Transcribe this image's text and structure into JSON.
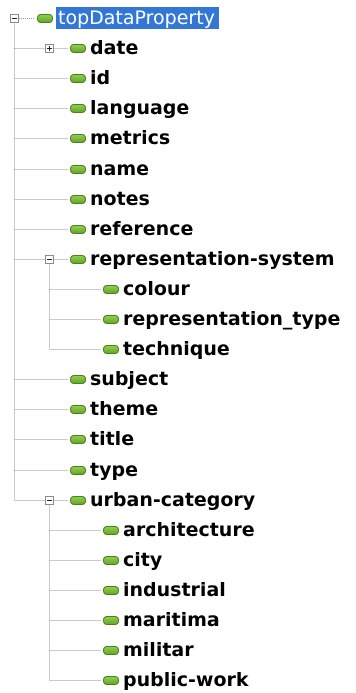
{
  "tree": {
    "nodes": [
      {
        "label": "topDataProperty",
        "depth": 0,
        "selected": true,
        "toggle": "minus",
        "icon": "data-property-icon"
      },
      {
        "label": "date",
        "depth": 1,
        "toggle": "plus",
        "icon": "data-property-icon"
      },
      {
        "label": "id",
        "depth": 1,
        "icon": "data-property-icon"
      },
      {
        "label": "language",
        "depth": 1,
        "icon": "data-property-icon"
      },
      {
        "label": "metrics",
        "depth": 1,
        "icon": "data-property-icon"
      },
      {
        "label": "name",
        "depth": 1,
        "icon": "data-property-icon"
      },
      {
        "label": "notes",
        "depth": 1,
        "icon": "data-property-icon"
      },
      {
        "label": "reference",
        "depth": 1,
        "icon": "data-property-icon"
      },
      {
        "label": "representation-system",
        "depth": 1,
        "toggle": "minus",
        "icon": "data-property-icon"
      },
      {
        "label": "colour",
        "depth": 2,
        "icon": "data-property-icon"
      },
      {
        "label": "representation_type",
        "depth": 2,
        "icon": "data-property-icon"
      },
      {
        "label": "technique",
        "depth": 2,
        "icon": "data-property-icon"
      },
      {
        "label": "subject",
        "depth": 1,
        "icon": "data-property-icon"
      },
      {
        "label": "theme",
        "depth": 1,
        "icon": "data-property-icon"
      },
      {
        "label": "title",
        "depth": 1,
        "icon": "data-property-icon"
      },
      {
        "label": "type",
        "depth": 1,
        "icon": "data-property-icon"
      },
      {
        "label": "urban-category",
        "depth": 1,
        "toggle": "minus",
        "icon": "data-property-icon"
      },
      {
        "label": "architecture",
        "depth": 2,
        "icon": "data-property-icon"
      },
      {
        "label": "city",
        "depth": 2,
        "icon": "data-property-icon"
      },
      {
        "label": "industrial",
        "depth": 2,
        "icon": "data-property-icon"
      },
      {
        "label": "maritima",
        "depth": 2,
        "icon": "data-property-icon"
      },
      {
        "label": "militar",
        "depth": 2,
        "icon": "data-property-icon"
      },
      {
        "label": "public-work",
        "depth": 2,
        "icon": "data-property-icon"
      }
    ],
    "colors": {
      "selection": "#3277d6",
      "icon_green": "#6aa82c",
      "connector": "#9a9a9a"
    }
  }
}
